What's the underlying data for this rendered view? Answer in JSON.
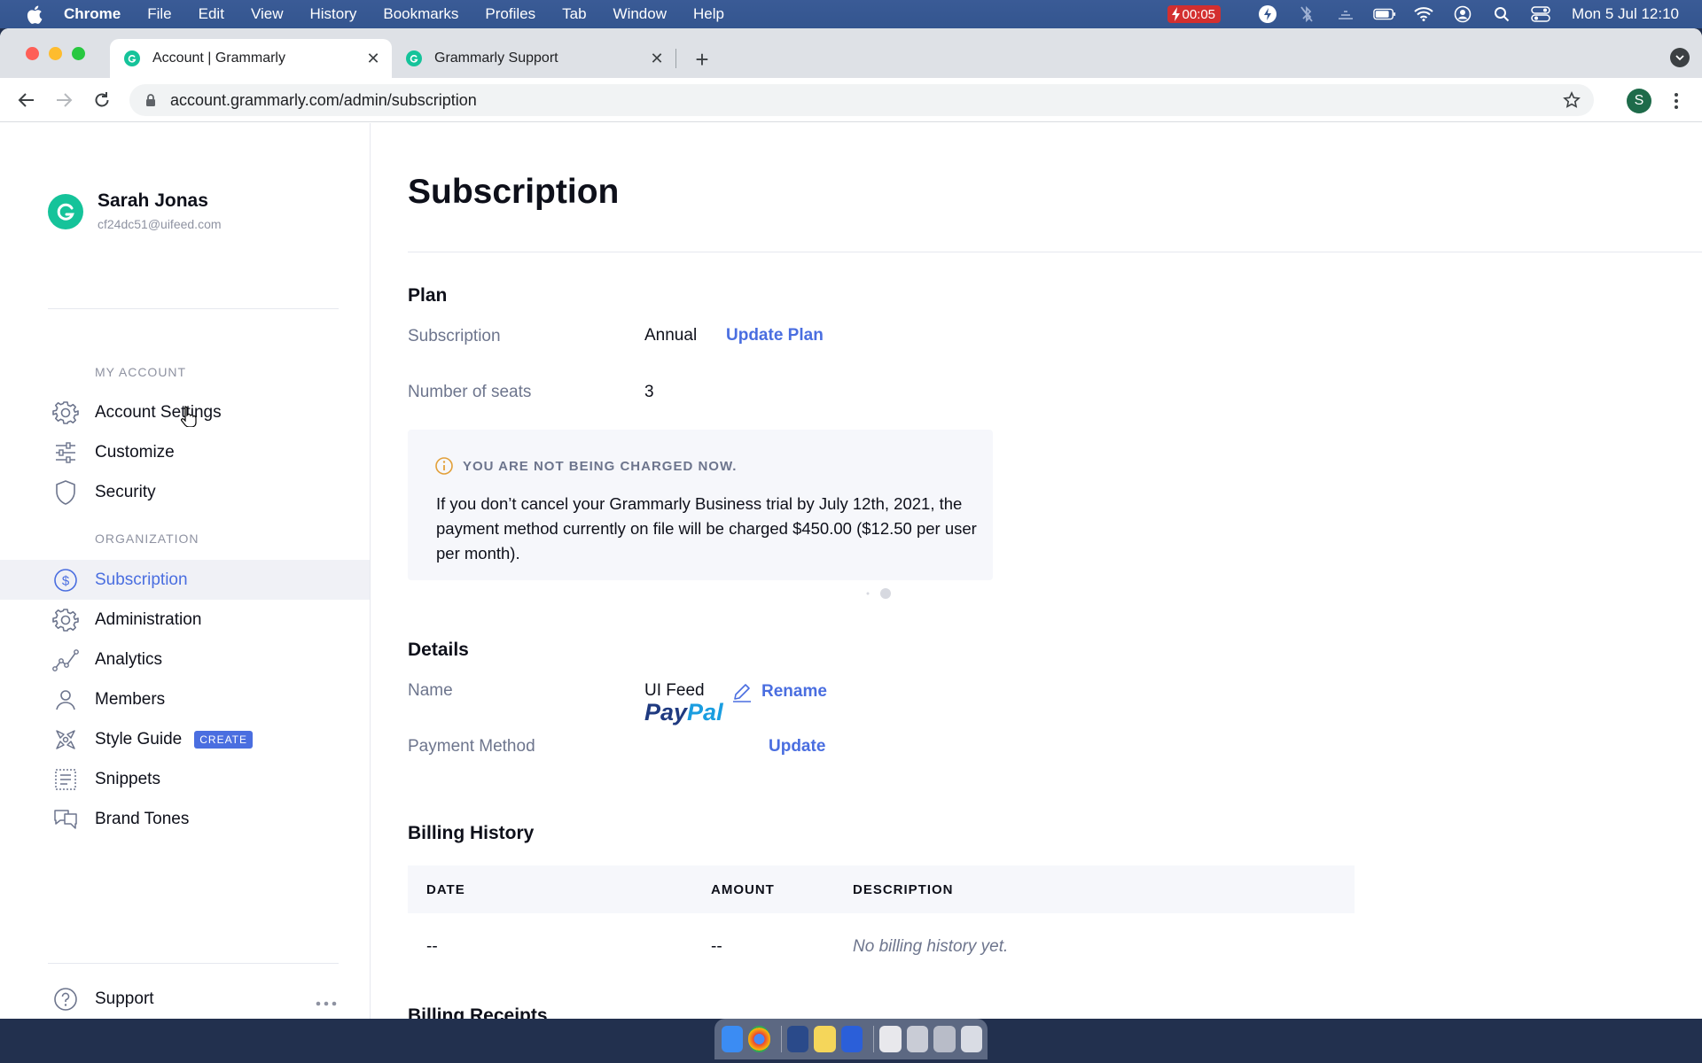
{
  "menubar": {
    "app_name": "Chrome",
    "items": [
      "File",
      "Edit",
      "View",
      "History",
      "Bookmarks",
      "Profiles",
      "Tab",
      "Window",
      "Help"
    ],
    "recording_time": "00:05",
    "datetime": "Mon 5 Jul  12:10"
  },
  "browser": {
    "tabs": [
      {
        "title": "Account | Grammarly",
        "active": true
      },
      {
        "title": "Grammarly Support",
        "active": false
      }
    ],
    "url": "account.grammarly.com/admin/subscription",
    "profile_initial": "S"
  },
  "sidebar": {
    "user_name": "Sarah Jonas",
    "user_email": "cf24dc51@uifeed.com",
    "sections": {
      "my_account": "MY ACCOUNT",
      "organization": "ORGANIZATION"
    },
    "my_account_items": [
      {
        "label": "Account Settings",
        "icon": "gear-icon"
      },
      {
        "label": "Customize",
        "icon": "sliders-icon"
      },
      {
        "label": "Security",
        "icon": "shield-icon"
      }
    ],
    "organization_items": [
      {
        "label": "Subscription",
        "icon": "dollar-icon",
        "active": true
      },
      {
        "label": "Administration",
        "icon": "gear-icon"
      },
      {
        "label": "Analytics",
        "icon": "analytics-icon"
      },
      {
        "label": "Members",
        "icon": "person-icon"
      },
      {
        "label": "Style Guide",
        "icon": "style-guide-icon",
        "badge": "CREATE"
      },
      {
        "label": "Snippets",
        "icon": "snippets-icon"
      },
      {
        "label": "Brand Tones",
        "icon": "brand-tones-icon"
      }
    ],
    "support_label": "Support"
  },
  "main": {
    "title": "Subscription",
    "plan": {
      "heading": "Plan",
      "subscription_label": "Subscription",
      "subscription_value": "Annual",
      "update_plan_link": "Update Plan",
      "seats_label": "Number of seats",
      "seats_value": "3"
    },
    "notice": {
      "heading": "YOU ARE NOT BEING CHARGED NOW.",
      "body": "If you don’t cancel your Grammarly Business trial by July 12th, 2021, the payment method currently on file will be charged $450.00 ($12.50 per user per month)."
    },
    "details": {
      "heading": "Details",
      "name_label": "Name",
      "name_value": "UI Feed",
      "rename_link": "Rename",
      "payment_label": "Payment Method",
      "payment_brand_pay": "Pay",
      "payment_brand_pal": "Pal",
      "update_link": "Update"
    },
    "billing_history": {
      "heading": "Billing History",
      "columns": [
        "DATE",
        "AMOUNT",
        "DESCRIPTION"
      ],
      "row": {
        "date": "--",
        "amount": "--",
        "description": "No billing history yet."
      }
    },
    "billing_receipts_heading": "Billing Receipts"
  },
  "colors": {
    "accent": "#4a6ee0",
    "grammarly_green": "#15c39a",
    "menubar": "#34558f"
  }
}
